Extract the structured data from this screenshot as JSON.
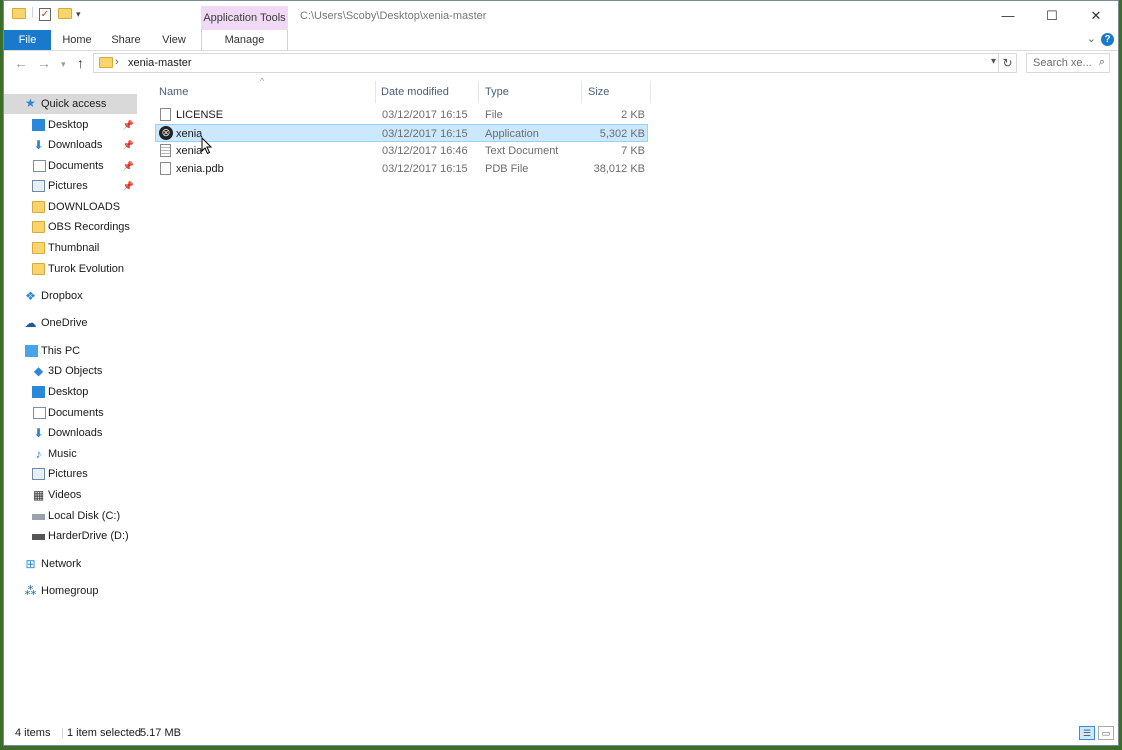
{
  "titlebar": {
    "context_tab": "Application Tools",
    "path": "C:\\Users\\Scoby\\Desktop\\xenia-master",
    "minimize": "—",
    "maximize": "☐",
    "close": "✕"
  },
  "ribbon": {
    "tabs": [
      "File",
      "Home",
      "Share",
      "View",
      "Manage"
    ],
    "help": "?"
  },
  "address": {
    "crumb": "xenia-master",
    "search_placeholder": "Search xe..."
  },
  "nav": {
    "quick_access": "Quick access",
    "qa_items": [
      "Desktop",
      "Downloads",
      "Documents",
      "Pictures",
      "DOWNLOADS",
      "OBS Recordings",
      "Thumbnail",
      "Turok Evolution"
    ],
    "dropbox": "Dropbox",
    "onedrive": "OneDrive",
    "this_pc": "This PC",
    "pc_items": [
      "3D Objects",
      "Desktop",
      "Documents",
      "Downloads",
      "Music",
      "Pictures",
      "Videos",
      "Local Disk (C:)",
      "HarderDrive (D:)"
    ],
    "network": "Network",
    "homegroup": "Homegroup"
  },
  "columns": {
    "name": "Name",
    "date": "Date modified",
    "type": "Type",
    "size": "Size"
  },
  "files": [
    {
      "name": "LICENSE",
      "date": "03/12/2017 16:15",
      "type": "File",
      "size": "2 KB"
    },
    {
      "name": "xenia",
      "date": "03/12/2017 16:15",
      "type": "Application",
      "size": "5,302 KB"
    },
    {
      "name": "xenia",
      "date": "03/12/2017 16:46",
      "type": "Text Document",
      "size": "7 KB"
    },
    {
      "name": "xenia.pdb",
      "date": "03/12/2017 16:15",
      "type": "PDB File",
      "size": "38,012 KB"
    }
  ],
  "status": {
    "count": "4 items",
    "selection": "1 item selected",
    "size": "5.17 MB"
  }
}
